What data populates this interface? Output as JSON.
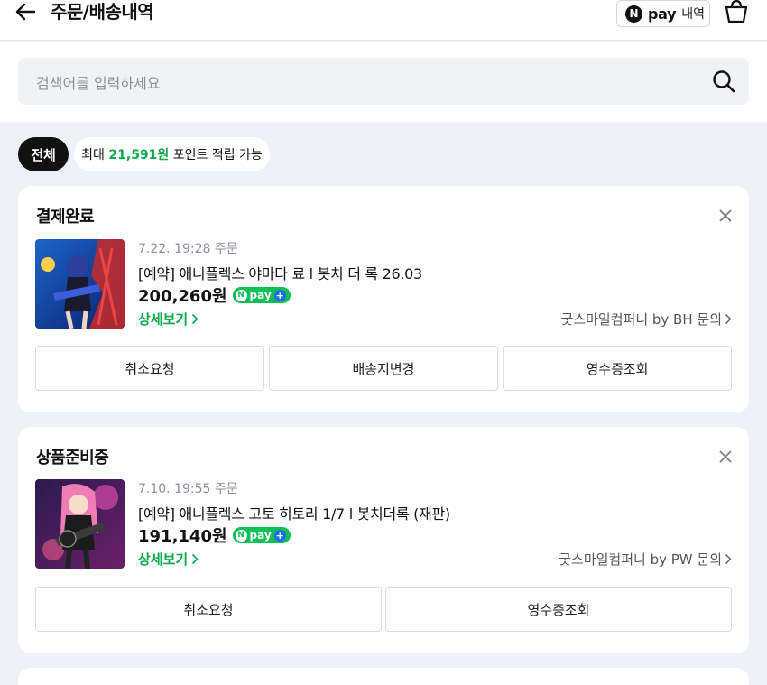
{
  "header": {
    "title": "주문/배송내역",
    "npay_n": "N",
    "npay_word": "pay",
    "npay_sub": "내역"
  },
  "search": {
    "placeholder": "검색어를 입력하세요"
  },
  "filters": {
    "all_label": "전체",
    "point_prefix": "최대",
    "point_amount": "21,591원",
    "point_suffix": "포인트 적립 가능"
  },
  "badge": {
    "n": "N",
    "word": "pay",
    "plus": "+"
  },
  "orders": [
    {
      "status": "결제완료",
      "date": "7.22. 19:28 주문",
      "product": "[예약] 애니플렉스 야마다 료 l 봇치 더 록 26.03",
      "price": "200,260원",
      "detail": "상세보기",
      "seller": "굿스마일컴퍼니 by BH 문의",
      "buttons": [
        "취소요청",
        "배송지변경",
        "영수증조회"
      ]
    },
    {
      "status": "상품준비중",
      "date": "7.10. 19:55 주문",
      "product": "[예약] 애니플렉스 고토 히토리 1/7 l 봇치더록 (재판)",
      "price": "191,140원",
      "detail": "상세보기",
      "seller": "굿스마일컴퍼니 by PW 문의",
      "buttons": [
        "취소요청",
        "영수증조회"
      ]
    }
  ],
  "colors": {
    "accent_green": "#10a84d",
    "npay_green": "#0ebf55",
    "plus_blue": "#1f6bf5"
  }
}
